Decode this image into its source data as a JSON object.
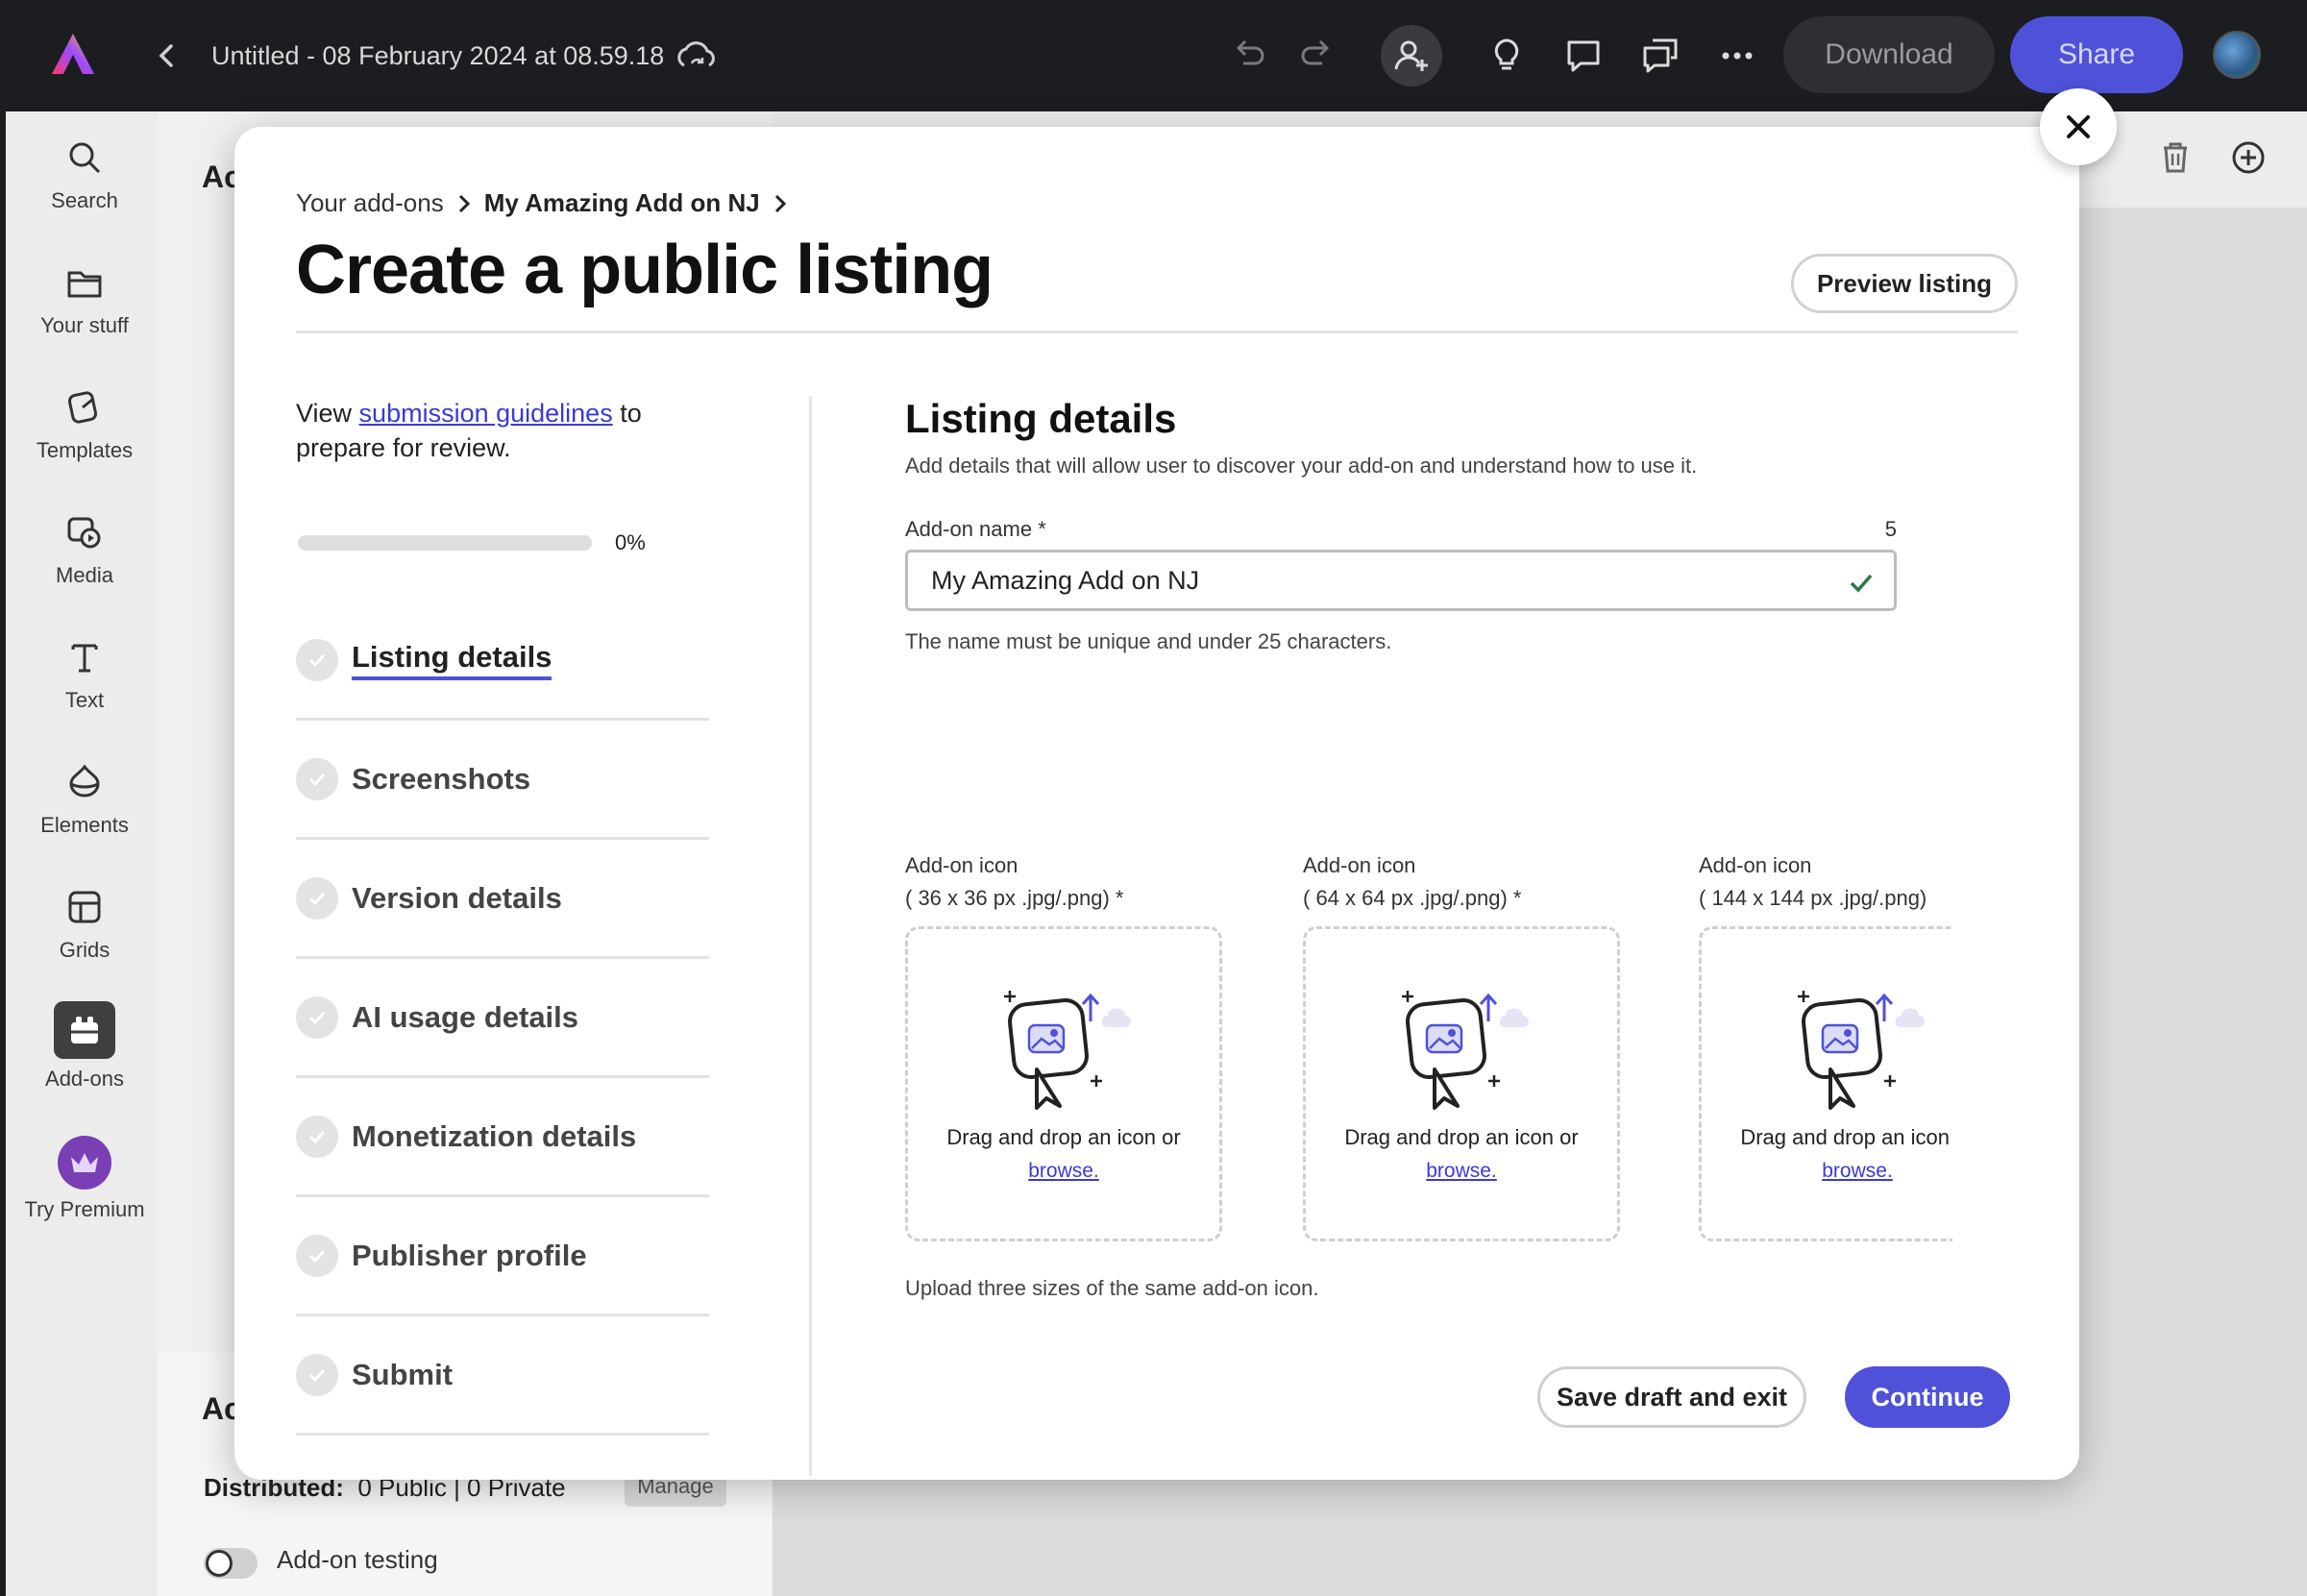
{
  "topbar": {
    "title": "Untitled - 08 February 2024 at 08.59.18",
    "download_label": "Download",
    "share_label": "Share",
    "icons": [
      "adobe-express-logo",
      "back-icon",
      "cloud-sync-icon",
      "undo-icon",
      "redo-icon",
      "invite-person-icon",
      "lightbulb-icon",
      "comment-icon",
      "chat-icon",
      "more-icon"
    ]
  },
  "rail": {
    "items": [
      {
        "label": "Search",
        "icon": "search-icon"
      },
      {
        "label": "Your stuff",
        "icon": "folder-icon"
      },
      {
        "label": "Templates",
        "icon": "templates-icon"
      },
      {
        "label": "Media",
        "icon": "media-icon"
      },
      {
        "label": "Text",
        "icon": "text-icon"
      },
      {
        "label": "Elements",
        "icon": "elements-icon"
      },
      {
        "label": "Grids",
        "icon": "grids-icon"
      },
      {
        "label": "Add-ons",
        "icon": "addons-icon"
      },
      {
        "label": "Try Premium",
        "icon": "crown-icon"
      }
    ]
  },
  "background": {
    "panel_heading_top": "Ac",
    "panel_heading_bottom": "Ac",
    "distributed_label": "Distributed:",
    "distributed_value": "0 Public | 0 Private",
    "manage_label": "Manage",
    "addon_testing_label": "Add-on testing"
  },
  "modal": {
    "breadcrumb": [
      "Your add-ons",
      "My Amazing Add on NJ"
    ],
    "title": "Create a public listing",
    "preview_label": "Preview listing",
    "guide_prefix": "View ",
    "guide_link": "submission guidelines",
    "guide_suffix": " to prepare for review.",
    "progress": {
      "value": 0,
      "label": "0%"
    },
    "steps": [
      {
        "label": "Listing details",
        "active": true
      },
      {
        "label": "Screenshots",
        "active": false
      },
      {
        "label": "Version details",
        "active": false
      },
      {
        "label": "AI usage details",
        "active": false
      },
      {
        "label": "Monetization details",
        "active": false
      },
      {
        "label": "Publisher profile",
        "active": false
      },
      {
        "label": "Submit",
        "active": false
      }
    ],
    "section": {
      "title": "Listing details",
      "description": "Add details that will allow user to discover your add-on and understand how to use it.",
      "name_label": "Add-on name *",
      "name_counter": "5",
      "name_value": "My Amazing Add on NJ",
      "name_helper": "The name must be unique and under 25 characters.",
      "icon_boxes": [
        {
          "label": "Add-on icon",
          "size": "( 36 x 36 px .jpg/.png) *",
          "drop_text": "Drag and drop an icon or",
          "browse": "browse."
        },
        {
          "label": "Add-on icon",
          "size": "( 64 x 64 px .jpg/.png) *",
          "drop_text": "Drag and drop an icon or",
          "browse": "browse."
        },
        {
          "label": "Add-on icon",
          "size": "( 144 x 144 px .jpg/.png)",
          "drop_text": "Drag and drop an icon or",
          "browse": "browse."
        }
      ],
      "upload_note": "Upload three sizes of the same add-on icon."
    },
    "save_label": "Save draft and exit",
    "continue_label": "Continue"
  },
  "colors": {
    "accent": "#4f52d8",
    "topbar": "#1c1d21"
  }
}
